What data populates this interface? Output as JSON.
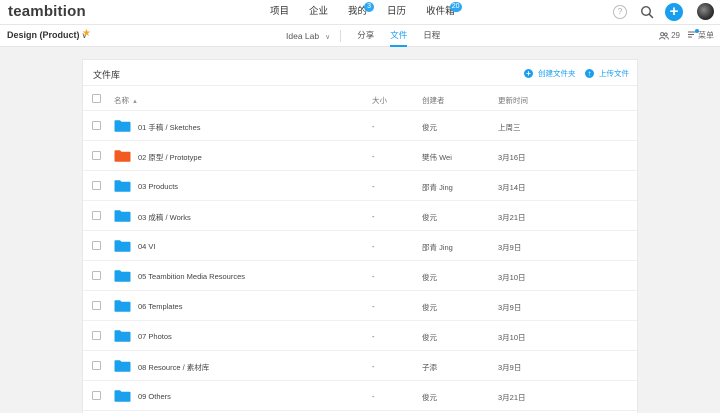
{
  "app": {
    "logo": "teambition"
  },
  "topnav": [
    {
      "label": "项目",
      "badge": ""
    },
    {
      "label": "企业",
      "badge": ""
    },
    {
      "label": "我的",
      "badge": "3"
    },
    {
      "label": "日历",
      "badge": ""
    },
    {
      "label": "收件箱",
      "badge": "20"
    }
  ],
  "topright": {
    "help": "?",
    "add": "+"
  },
  "project": {
    "title": "Design (Product)",
    "chevron": "∨",
    "star": "★",
    "tabs": [
      {
        "label": "Idea Lab",
        "chevron": "∨"
      },
      {
        "label": "分享"
      },
      {
        "label": "文件"
      },
      {
        "label": "日程"
      }
    ],
    "members_count": "29",
    "menu_label": "菜单"
  },
  "library": {
    "title": "文件库",
    "create_folder": "创建文件夹",
    "upload_file": "上传文件",
    "columns": {
      "name": "名称",
      "size": "大小",
      "creator": "创建者",
      "updated": "更新时间"
    },
    "sort_caret": "▲",
    "rows": [
      {
        "name": "01 手稿 / Sketches",
        "size": "-",
        "creator": "俊元",
        "updated": "上周三",
        "color": "#1aa0ec"
      },
      {
        "name": "02 原型 / Prototype",
        "size": "-",
        "creator": "樊伟 Wei",
        "updated": "3月16日",
        "color": "#f25a22"
      },
      {
        "name": "03 Products",
        "size": "-",
        "creator": "邵青 Jing",
        "updated": "3月14日",
        "color": "#1aa0ec"
      },
      {
        "name": "03 成稿 / Works",
        "size": "-",
        "creator": "俊元",
        "updated": "3月21日",
        "color": "#1aa0ec"
      },
      {
        "name": "04 VI",
        "size": "-",
        "creator": "邵青 Jing",
        "updated": "3月9日",
        "color": "#1aa0ec"
      },
      {
        "name": "05 Teambition Media Resources",
        "size": "-",
        "creator": "俊元",
        "updated": "3月10日",
        "color": "#1aa0ec"
      },
      {
        "name": "06 Templates",
        "size": "-",
        "creator": "俊元",
        "updated": "3月9日",
        "color": "#1aa0ec"
      },
      {
        "name": "07 Photos",
        "size": "-",
        "creator": "俊元",
        "updated": "3月10日",
        "color": "#1aa0ec"
      },
      {
        "name": "08 Resource / 素材库",
        "size": "-",
        "creator": "子添",
        "updated": "3月9日",
        "color": "#1aa0ec"
      },
      {
        "name": "09 Others",
        "size": "-",
        "creator": "俊元",
        "updated": "3月21日",
        "color": "#1aa0ec"
      }
    ]
  },
  "colors": {
    "accent": "#1a9ff0",
    "star": "#f5a623"
  }
}
